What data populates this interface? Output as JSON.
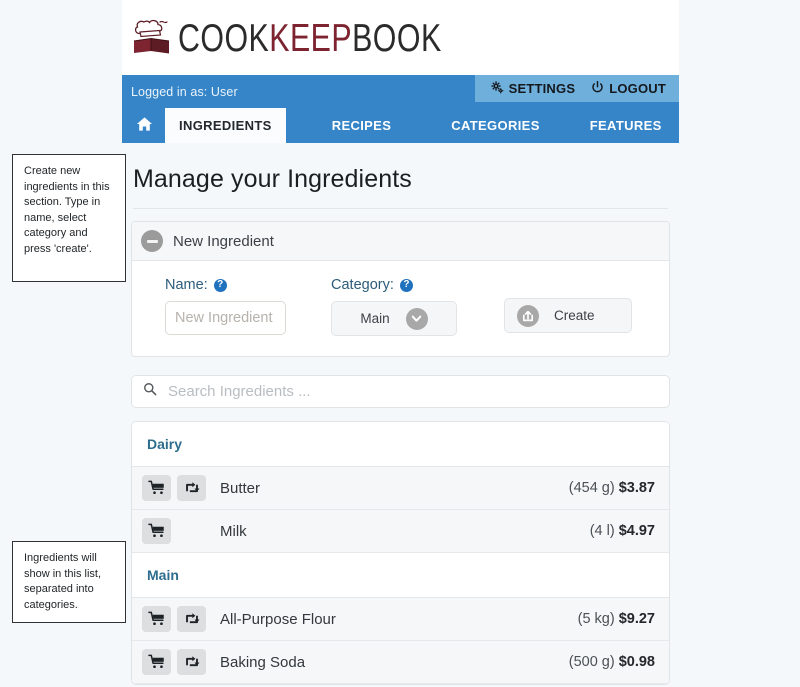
{
  "brand": {
    "name_part1": "COOK",
    "name_part2": "KEEP",
    "name_part3": "BOOK",
    "logo_icon": "chef-hat-book-icon",
    "color_dark": "#2b2b2b",
    "color_red": "#7d2430"
  },
  "userbar": {
    "logged_in_text": "Logged in as: User",
    "settings_label": "SETTINGS",
    "settings_icon": "gear-icon",
    "logout_label": "LOGOUT",
    "logout_icon": "power-icon",
    "bar_color": "#3585c8",
    "acct_box_color": "#6fafdc"
  },
  "nav": {
    "home_icon": "home-icon",
    "tabs": [
      {
        "label": "INGREDIENTS",
        "active": true
      },
      {
        "label": "RECIPES",
        "active": false
      },
      {
        "label": "CATEGORIES",
        "active": false
      },
      {
        "label": "FEATURES",
        "active": false
      }
    ]
  },
  "main": {
    "page_title": "Manage your Ingredients",
    "panel": {
      "collapse_icon": "minus-circle-icon",
      "title": "New Ingredient",
      "name_label": "Name:",
      "name_help_icon": "question-circle-icon",
      "name_placeholder": "New Ingredient",
      "name_value": "",
      "category_label": "Category:",
      "category_help_icon": "question-circle-icon",
      "category_selected": "Main",
      "category_chevron_icon": "chevron-down-icon",
      "create_label": "Create",
      "create_icon": "export-box-icon"
    },
    "search": {
      "icon": "search-icon",
      "placeholder": "Search Ingredients ...",
      "value": ""
    },
    "list": {
      "groups": [
        {
          "category": "Dairy",
          "items": [
            {
              "name": "Butter",
              "amount": "(454 g)",
              "price": "$3.87",
              "cart_icon": "shopping-cart-icon",
              "swap_icon": "swap-arrows-icon",
              "has_swap": true
            },
            {
              "name": "Milk",
              "amount": "(4 l)",
              "price": "$4.97",
              "cart_icon": "shopping-cart-icon",
              "swap_icon": "swap-arrows-icon",
              "has_swap": false
            }
          ]
        },
        {
          "category": "Main",
          "items": [
            {
              "name": "All-Purpose Flour",
              "amount": "(5 kg)",
              "price": "$9.27",
              "cart_icon": "shopping-cart-icon",
              "swap_icon": "swap-arrows-icon",
              "has_swap": true
            },
            {
              "name": "Baking Soda",
              "amount": "(500 g)",
              "price": "$0.98",
              "cart_icon": "shopping-cart-icon",
              "swap_icon": "swap-arrows-icon",
              "has_swap": true
            }
          ]
        }
      ]
    }
  },
  "annotations": [
    {
      "id": "create",
      "text": "Create new ingredients in this section. Type in name, select category and press 'create'."
    },
    {
      "id": "list",
      "text": "Ingredients will show in this list, separated into categories."
    }
  ]
}
